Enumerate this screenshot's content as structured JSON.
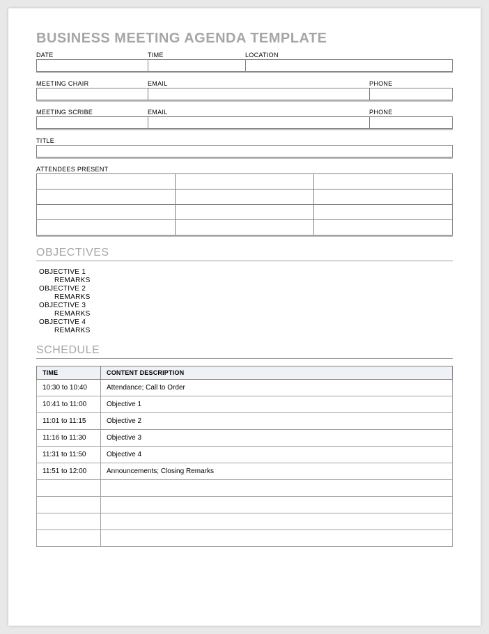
{
  "title": "BUSINESS MEETING AGENDA TEMPLATE",
  "row1": {
    "date_label": "DATE",
    "time_label": "TIME",
    "location_label": "LOCATION"
  },
  "row2": {
    "chair_label": "MEETING CHAIR",
    "email_label": "EMAIL",
    "phone_label": "PHONE"
  },
  "row3": {
    "scribe_label": "MEETING SCRIBE",
    "email_label": "EMAIL",
    "phone_label": "PHONE"
  },
  "row4": {
    "title_label": "TITLE"
  },
  "row5": {
    "attendees_label": "ATTENDEES PRESENT"
  },
  "objectives": {
    "heading": "OBJECTIVES",
    "items": [
      {
        "label": "OBJECTIVE 1",
        "remarks": "REMARKS"
      },
      {
        "label": "OBJECTIVE 2",
        "remarks": "REMARKS"
      },
      {
        "label": "OBJECTIVE 3",
        "remarks": "REMARKS"
      },
      {
        "label": "OBJECTIVE 4",
        "remarks": "REMARKS"
      }
    ]
  },
  "schedule": {
    "heading": "SCHEDULE",
    "headers": {
      "time": "TIME",
      "content": "CONTENT DESCRIPTION"
    },
    "rows": [
      {
        "time": "10:30 to 10:40",
        "content": "Attendance; Call to Order"
      },
      {
        "time": "10:41 to 11:00",
        "content": "Objective 1"
      },
      {
        "time": "11:01 to 11:15",
        "content": "Objective 2"
      },
      {
        "time": "11:16 to 11:30",
        "content": "Objective 3"
      },
      {
        "time": "11:31 to 11:50",
        "content": "Objective 4"
      },
      {
        "time": "11:51 to 12:00",
        "content": "Announcements; Closing Remarks"
      },
      {
        "time": "",
        "content": ""
      },
      {
        "time": "",
        "content": ""
      },
      {
        "time": "",
        "content": ""
      },
      {
        "time": "",
        "content": ""
      }
    ]
  }
}
